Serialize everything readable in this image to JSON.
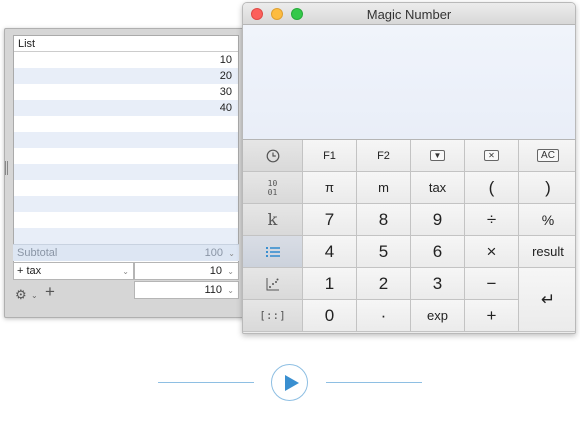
{
  "list_window": {
    "header": "List",
    "rows": [
      "10",
      "20",
      "30",
      "40",
      "",
      "",
      "",
      "",
      "",
      "",
      "",
      ""
    ],
    "subtotal_label": "Subtotal",
    "subtotal_value": "100",
    "tax_label": "+ tax",
    "tax_value": "10",
    "total_value": "110"
  },
  "calculator": {
    "title": "Magic Number",
    "keys": {
      "f1": "F1",
      "f2": "F2",
      "ac": "AC",
      "pi": "π",
      "m": "m",
      "tax": "tax",
      "lparen": "(",
      "rparen": ")",
      "seven": "7",
      "eight": "8",
      "nine": "9",
      "divide": "÷",
      "percent": "%",
      "four": "4",
      "five": "5",
      "six": "6",
      "multiply": "×",
      "result": "result",
      "one": "1",
      "two": "2",
      "three": "3",
      "minus": "−",
      "enter": "↵",
      "zero": "0",
      "dot": "·",
      "exp": "exp",
      "plus": "+"
    },
    "side_labels": {
      "binary": "10\n01",
      "constant": "k",
      "matrix": "[::]"
    }
  },
  "colors": {
    "accent": "#3a8fd0",
    "display_bg": "#edf1f9",
    "close": "#fc605c",
    "minimize": "#fdbc40",
    "zoom": "#34c84a"
  },
  "icons": [
    "clock-icon",
    "binary-icon",
    "constant-k-icon",
    "list-icon",
    "scatter-icon",
    "matrix-icon",
    "gear-icon",
    "add-icon",
    "play-icon",
    "dropdown-arrow-icon",
    "clear-box-icon",
    "return-icon"
  ]
}
